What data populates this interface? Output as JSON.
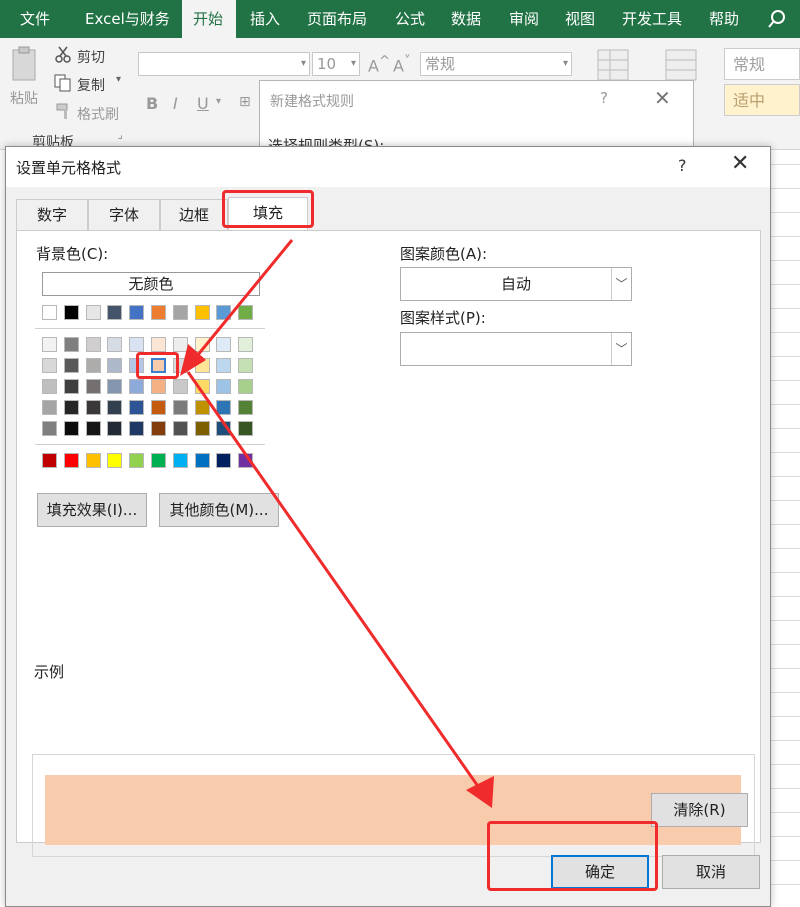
{
  "ribbon": {
    "tabs": [
      "文件",
      "Excel与财务",
      "开始",
      "插入",
      "页面布局",
      "公式",
      "数据",
      "审阅",
      "视图",
      "开发工具",
      "帮助"
    ],
    "active_tab": "开始",
    "paste_label": "粘贴",
    "cut_label": "剪切",
    "copy_label": "复制",
    "format_painter_label": "格式刷",
    "clipboard_group_label": "剪贴板",
    "font_size": "10",
    "number_format": "常规",
    "style_normal": "常规",
    "style_neutral": "适中",
    "bold": "B",
    "italic": "I",
    "underline": "U"
  },
  "background_dialog": {
    "title": "新建格式规则",
    "help": "?",
    "select_rule_type_label": "选择规则类型(S):"
  },
  "dialog": {
    "title": "设置单元格格式",
    "help": "?",
    "tabs": [
      "数字",
      "字体",
      "边框",
      "填充"
    ],
    "active_tab": "填充",
    "background_color_label": "背景色(C):",
    "no_color_label": "无颜色",
    "pattern_color_label": "图案颜色(A):",
    "pattern_color_value": "自动",
    "pattern_style_label": "图案样式(P):",
    "pattern_style_value": "",
    "fill_effects_button": "填充效果(I)...",
    "more_colors_button": "其他颜色(M)...",
    "sample_label": "示例",
    "sample_color": "#F8CBAD",
    "selected_swatch_color": "#F8CBAD",
    "clear_button": "清除(R)",
    "ok_button": "确定",
    "cancel_button": "取消",
    "theme_colors_top": [
      "#FFFFFF",
      "#000000",
      "#E7E6E6",
      "#44546A",
      "#4472C4",
      "#ED7D31",
      "#A5A5A5",
      "#FFC000",
      "#5B9BD5",
      "#70AD47"
    ],
    "theme_colors_tints": [
      [
        "#F2F2F2",
        "#7F7F7F",
        "#D0CECE",
        "#D6DCE4",
        "#D9E2F3",
        "#FBE5D5",
        "#EDEDED",
        "#FFF2CC",
        "#DEEBF6",
        "#E2EFD9"
      ],
      [
        "#D8D8D8",
        "#595959",
        "#AEABAB",
        "#ADB9CA",
        "#B4C6E7",
        "#F8CBAD",
        "#DBDBDB",
        "#FFE598",
        "#BDD7EE",
        "#C5E0B3"
      ],
      [
        "#BFBFBF",
        "#3F3F3F",
        "#757070",
        "#8496B0",
        "#8EAADB",
        "#F4B183",
        "#C9C9C9",
        "#FFD965",
        "#9DC3E6",
        "#A8D08D"
      ],
      [
        "#A5A5A5",
        "#262626",
        "#3A3838",
        "#323F4F",
        "#2F5496",
        "#C55A11",
        "#7B7B7B",
        "#BF9000",
        "#2E75B5",
        "#538135"
      ],
      [
        "#7F7F7F",
        "#0C0C0C",
        "#171616",
        "#222A35",
        "#1F3864",
        "#833C0B",
        "#525252",
        "#7F6000",
        "#1E4E79",
        "#375623"
      ]
    ],
    "standard_colors": [
      "#C00000",
      "#FF0000",
      "#FFC000",
      "#FFFF00",
      "#92D050",
      "#00B050",
      "#00B0F0",
      "#0070C0",
      "#002060",
      "#7030A0"
    ]
  },
  "annotation_color": "#EF2B2B"
}
